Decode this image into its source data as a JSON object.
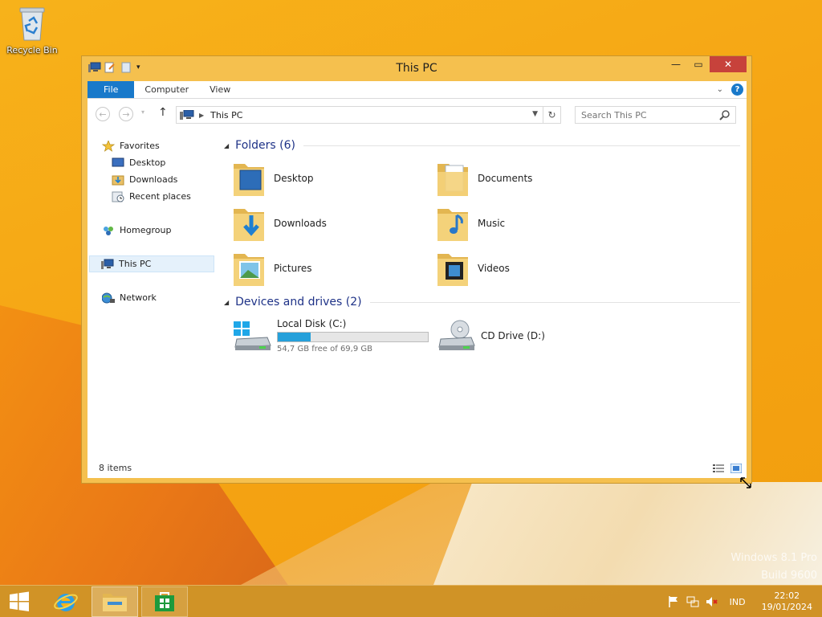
{
  "desktop": {
    "recycle_bin_label": "Recycle Bin",
    "watermark": {
      "line1": "Windows 8.1 Pro",
      "line2": "Build 9600"
    }
  },
  "window": {
    "title": "This PC",
    "ribbon": {
      "tabs": [
        "File",
        "Computer",
        "View"
      ]
    },
    "address": {
      "crumb": "This PC"
    },
    "search": {
      "placeholder": "Search This PC"
    },
    "nav": {
      "favorites": "Favorites",
      "desktop": "Desktop",
      "downloads": "Downloads",
      "recent": "Recent places",
      "homegroup": "Homegroup",
      "this_pc": "This PC",
      "network": "Network"
    },
    "folders_group": "Folders (6)",
    "folders": [
      "Desktop",
      "Documents",
      "Downloads",
      "Music",
      "Pictures",
      "Videos"
    ],
    "devices_group": "Devices and drives (2)",
    "drives": {
      "c": {
        "name": "Local Disk (C:)",
        "free_text": "54,7 GB free of 69,9 GB",
        "used_fraction": 0.217
      },
      "d": {
        "name": "CD Drive (D:)"
      }
    },
    "status": "8 items"
  },
  "taskbar": {
    "language": "IND",
    "time": "22:02",
    "date": "19/01/2024"
  },
  "colors": {
    "accent": "#1979ca",
    "group_title": "#1e3287",
    "drive_bar": "#26a0da",
    "close_button": "#c7423b"
  }
}
